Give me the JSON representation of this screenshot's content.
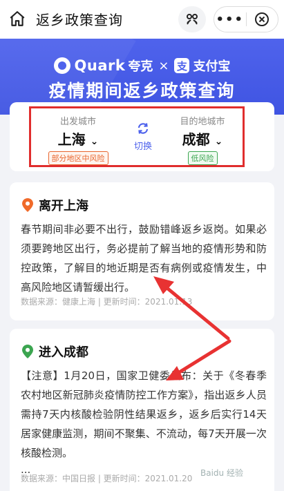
{
  "header": {
    "title": "返乡政策查询",
    "more_label": "•••"
  },
  "banner": {
    "brand_en": "Quark",
    "brand_cn": "夸克",
    "times": "×",
    "alipay_char": "支",
    "alipay_name": "支付宝",
    "title": "疫情期间返乡政策查询"
  },
  "selector": {
    "from_label": "出发城市",
    "from_city": "上海",
    "from_risk": "部分地区中风险",
    "swap_label": "切换",
    "to_label": "目的地城市",
    "to_city": "成都",
    "to_risk": "低风险",
    "chevron": "⌄"
  },
  "leave": {
    "title": "离开上海",
    "body": "春节期间非必要不出行，鼓励错峰返乡返岗。如果必须要跨地区出行，务必提前了解当地的疫情形势和防控政策，了解目的地近期是否有病例或疫情发生，中高风险地区请暂缓出行。",
    "source": "数据来源：健康上海 | 更新时间：2021.01.13"
  },
  "enter": {
    "title": "进入成都",
    "body": "【注意】1月20日，国家卫健委发布：关于《冬春季农村地区新冠肺炎疫情防控工作方案》，指出返乡人员需持7天内核酸检验阴性结果返乡，返乡后实行14天居家健康监测，期间不聚集、不流动，每7天开展一次核酸检测。",
    "ellipsis": "...",
    "source": "数据来源：中国日报 | 更新时间：2021.01.20"
  },
  "watermark": "Baidu 经验",
  "colors": {
    "brand_blue": "#4f63ec",
    "highlight_red": "#e02d2d",
    "mid_risk": "#e8652e",
    "low_risk": "#3ba550"
  }
}
